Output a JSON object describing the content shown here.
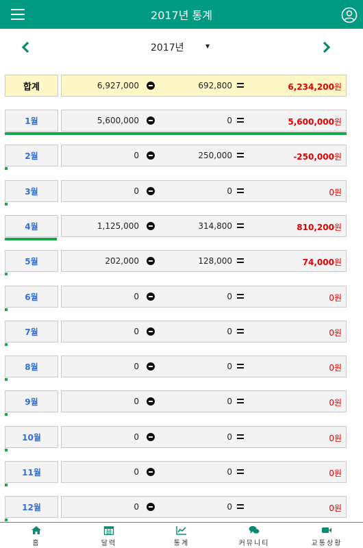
{
  "header": {
    "title": "2017년 통계"
  },
  "year_selector": {
    "value": "2017년",
    "caret": "▼"
  },
  "total": {
    "label": "합계",
    "income": "6,927,000",
    "expense": "692,800",
    "result": "6,234,200",
    "won": "원"
  },
  "months": [
    {
      "label": "1월",
      "income": "5,600,000",
      "expense": "0",
      "result": "5,600,000",
      "won": "원",
      "bold": true,
      "bar_fraction": 1.0
    },
    {
      "label": "2월",
      "income": "0",
      "expense": "250,000",
      "result": "-250,000",
      "won": "원",
      "bold": true,
      "bar_fraction": 0.0
    },
    {
      "label": "3월",
      "income": "0",
      "expense": "0",
      "result": "0",
      "won": "원",
      "bold": false,
      "bar_fraction": 0.0
    },
    {
      "label": "4월",
      "income": "1,125,000",
      "expense": "314,800",
      "result": "810,200",
      "won": "원",
      "bold": true,
      "bar_fraction": 0.145
    },
    {
      "label": "5월",
      "income": "202,000",
      "expense": "128,000",
      "result": "74,000",
      "won": "원",
      "bold": true,
      "bar_fraction": 0.0
    },
    {
      "label": "6월",
      "income": "0",
      "expense": "0",
      "result": "0",
      "won": "원",
      "bold": false,
      "bar_fraction": 0.0
    },
    {
      "label": "7월",
      "income": "0",
      "expense": "0",
      "result": "0",
      "won": "원",
      "bold": false,
      "bar_fraction": 0.0
    },
    {
      "label": "8월",
      "income": "0",
      "expense": "0",
      "result": "0",
      "won": "원",
      "bold": false,
      "bar_fraction": 0.0
    },
    {
      "label": "9월",
      "income": "0",
      "expense": "0",
      "result": "0",
      "won": "원",
      "bold": false,
      "bar_fraction": 0.0
    },
    {
      "label": "10월",
      "income": "0",
      "expense": "0",
      "result": "0",
      "won": "원",
      "bold": false,
      "bar_fraction": 0.0
    },
    {
      "label": "11월",
      "income": "0",
      "expense": "0",
      "result": "0",
      "won": "원",
      "bold": false,
      "bar_fraction": 0.0
    },
    {
      "label": "12월",
      "income": "0",
      "expense": "0",
      "result": "0",
      "won": "원",
      "bold": false,
      "bar_fraction": 0.0
    }
  ],
  "tabs": [
    {
      "label": "홈",
      "icon": "home-icon"
    },
    {
      "label": "달력",
      "icon": "calendar-icon"
    },
    {
      "label": "통계",
      "icon": "chart-icon"
    },
    {
      "label": "커뮤니티",
      "icon": "chat-icon"
    },
    {
      "label": "교통상황",
      "icon": "video-icon"
    }
  ],
  "colors": {
    "header": "#009a82",
    "bar": "#1aa64a",
    "result": "#e00000",
    "month_label": "#2f6fd8",
    "total_bg": "#fff8c6"
  }
}
